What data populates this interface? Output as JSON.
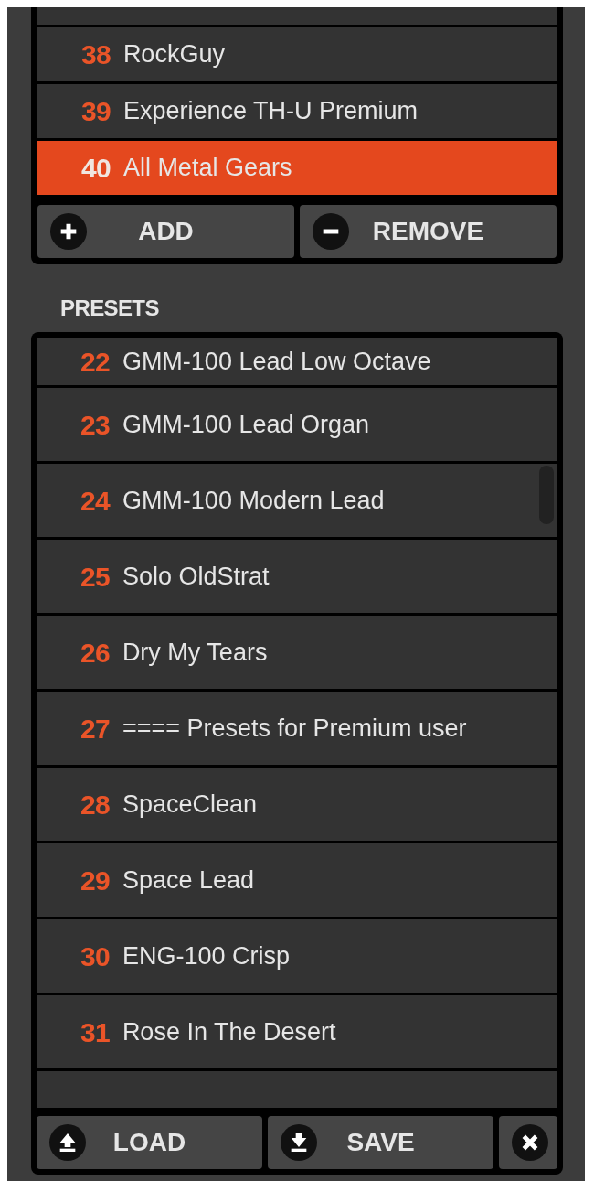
{
  "banks": {
    "items": [
      {
        "number": "38",
        "name": "RockGuy",
        "selected": false
      },
      {
        "number": "39",
        "name": "Experience TH-U Premium",
        "selected": false
      },
      {
        "number": "40",
        "name": "All Metal Gears",
        "selected": true
      }
    ],
    "buttons": [
      {
        "kind": "add",
        "label": "ADD"
      },
      {
        "kind": "remove",
        "label": "REMOVE"
      }
    ]
  },
  "presets": {
    "title": "PRESETS",
    "items": [
      {
        "number": "22",
        "name": "GMM-100 Lead Low Octave",
        "selected": false
      },
      {
        "number": "23",
        "name": "GMM-100 Lead Organ",
        "selected": false
      },
      {
        "number": "24",
        "name": "GMM-100 Modern Lead",
        "selected": false
      },
      {
        "number": "25",
        "name": "Solo OldStrat",
        "selected": false
      },
      {
        "number": "26",
        "name": "Dry My Tears",
        "selected": false
      },
      {
        "number": "27",
        "name": "==== Presets for Premium user",
        "selected": false
      },
      {
        "number": "28",
        "name": "SpaceClean",
        "selected": false
      },
      {
        "number": "29",
        "name": "Space Lead",
        "selected": false
      },
      {
        "number": "30",
        "name": "ENG-100 Crisp",
        "selected": false
      },
      {
        "number": "31",
        "name": "Rose In The Desert",
        "selected": false
      }
    ],
    "buttons": [
      {
        "kind": "load",
        "label": "LOAD"
      },
      {
        "kind": "save",
        "label": "SAVE"
      },
      {
        "kind": "close"
      }
    ]
  }
}
